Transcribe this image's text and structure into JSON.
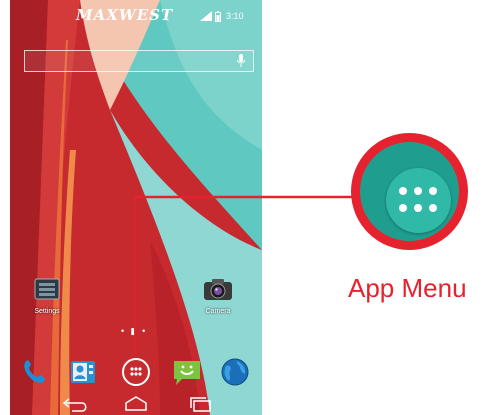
{
  "statusbar": {
    "brand": "MAXWEST",
    "time": "3:10",
    "icons": [
      "signal-icon",
      "battery-icon"
    ]
  },
  "search": {
    "icon": "mic-icon"
  },
  "desktop": {
    "items": [
      {
        "label": "Settings",
        "icon": "settings-app-icon"
      },
      {
        "label": "Camera",
        "icon": "camera-app-icon"
      }
    ]
  },
  "page_indicator": "• ▮ •",
  "dock": {
    "items": [
      "phone-app-icon",
      "contacts-app-icon",
      "app-menu-icon",
      "messaging-app-icon",
      "browser-app-icon"
    ]
  },
  "navbar": {
    "items": [
      "back-icon",
      "home-icon",
      "recents-icon"
    ]
  },
  "callout": {
    "label": "App Menu",
    "accent": "#e6222e",
    "button_color": "#31b9a8"
  }
}
